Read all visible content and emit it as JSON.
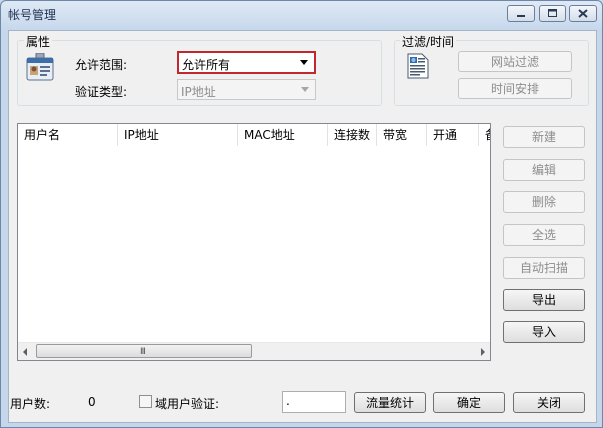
{
  "window": {
    "title": "帐号管理",
    "caption_buttons": {
      "minimize": "minimize-icon",
      "maximize": "maximize-icon",
      "close": "close-icon"
    }
  },
  "properties": {
    "title": "属性",
    "icon": "id-badge-icon",
    "scope_label": "允许范围:",
    "scope_value": "允许所有",
    "auth_type_label": "验证类型:",
    "auth_type_value": "IP地址"
  },
  "filter": {
    "title": "过滤/时间",
    "icon": "document-icon",
    "site_filter_button": "网站过滤",
    "schedule_button": "时间安排"
  },
  "table": {
    "columns": [
      "用户名",
      "IP地址",
      "MAC地址",
      "连接数",
      "带宽",
      "开通",
      "备"
    ],
    "rows": [],
    "scrollbar_grip": "III"
  },
  "side_buttons": {
    "new": "新建",
    "edit": "编辑",
    "delete": "删除",
    "select_all": "全选",
    "auto_scan": "自动扫描",
    "export": "导出",
    "import": "导入"
  },
  "footer": {
    "user_count_label": "用户数:",
    "user_count_value": "0",
    "domain_auth_label": "域用户验证:",
    "domain_auth_checked": false,
    "text_field_value": ".",
    "traffic_stats_button": "流量统计",
    "ok_button": "确定",
    "close_button": "关闭"
  },
  "colors": {
    "active_border": "#c1272d",
    "disabled_text": "#8d8d8d",
    "title_text": "#1e3050"
  }
}
